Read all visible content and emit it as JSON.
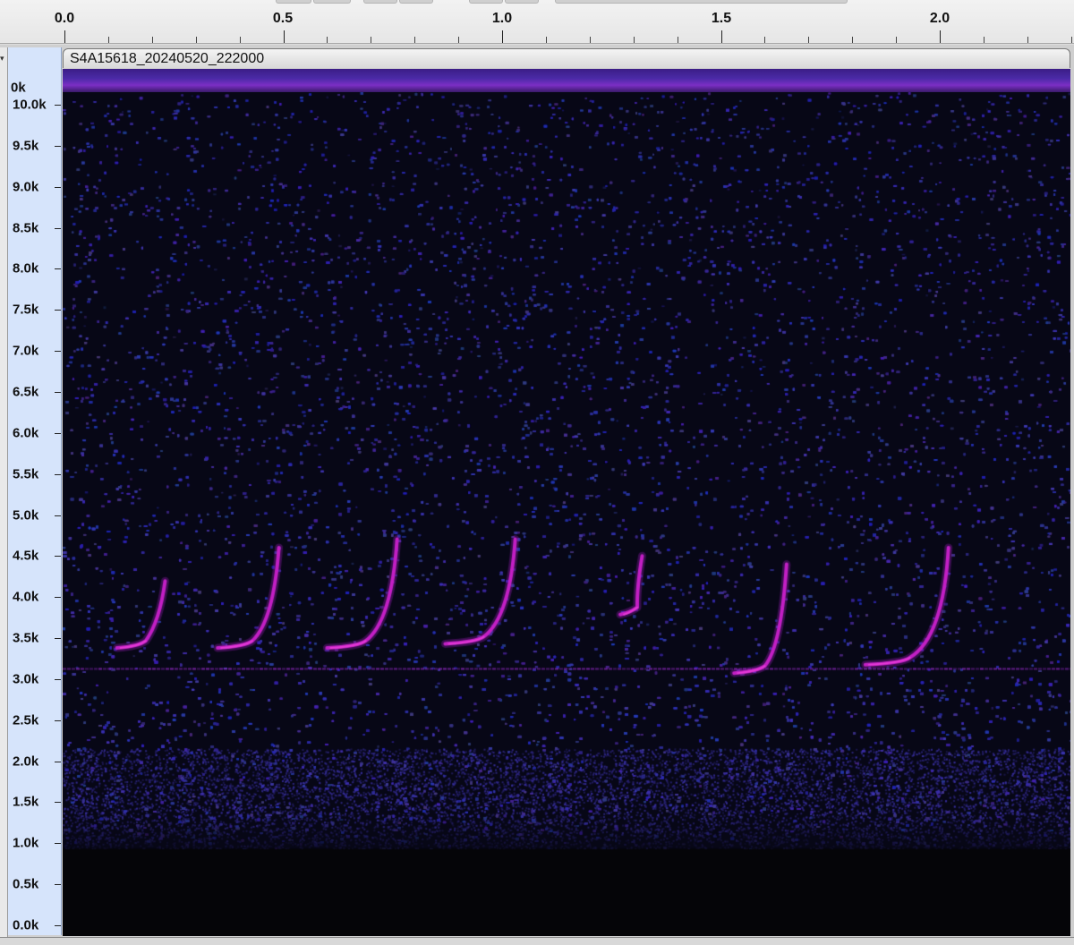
{
  "ruler": {
    "labels": [
      "0.0",
      "0.5",
      "1.0",
      "1.5",
      "2.0"
    ]
  },
  "track": {
    "clip_name": "S4A15618_20240520_222000",
    "top_label": "0k",
    "freq_labels": [
      "10.0k",
      "9.5k",
      "9.0k",
      "8.5k",
      "8.0k",
      "7.5k",
      "7.0k",
      "6.5k",
      "6.0k",
      "5.5k",
      "5.0k",
      "4.5k",
      "4.0k",
      "3.5k",
      "3.0k",
      "2.5k",
      "2.0k",
      "1.5k",
      "1.0k",
      "0.5k",
      "0.0k"
    ]
  },
  "spectrogram": {
    "time_range_s": [
      0,
      2.3
    ],
    "freq_range_hz": [
      0,
      10000
    ],
    "colors": {
      "background": "#070716",
      "noise": "#2a2a8a",
      "call": "#c21fc4",
      "call_bright": "#e43ad6"
    },
    "noise_floor_hz": 1000,
    "tone_hz": 3150,
    "calls": [
      {
        "t_start": 0.12,
        "t_end": 0.23,
        "f_start": 3400,
        "f_end": 4200
      },
      {
        "t_start": 0.35,
        "t_end": 0.49,
        "f_start": 3400,
        "f_end": 4600
      },
      {
        "t_start": 0.6,
        "t_end": 0.76,
        "f_start": 3400,
        "f_end": 4700
      },
      {
        "t_start": 0.87,
        "t_end": 1.03,
        "f_start": 3450,
        "f_end": 4700
      },
      {
        "t_start": 1.27,
        "t_end": 1.32,
        "f_start": 3800,
        "f_end": 4500
      },
      {
        "t_start": 1.53,
        "t_end": 1.65,
        "f_start": 3100,
        "f_end": 4400
      },
      {
        "t_start": 1.83,
        "t_end": 2.02,
        "f_start": 3200,
        "f_end": 4600
      }
    ]
  }
}
